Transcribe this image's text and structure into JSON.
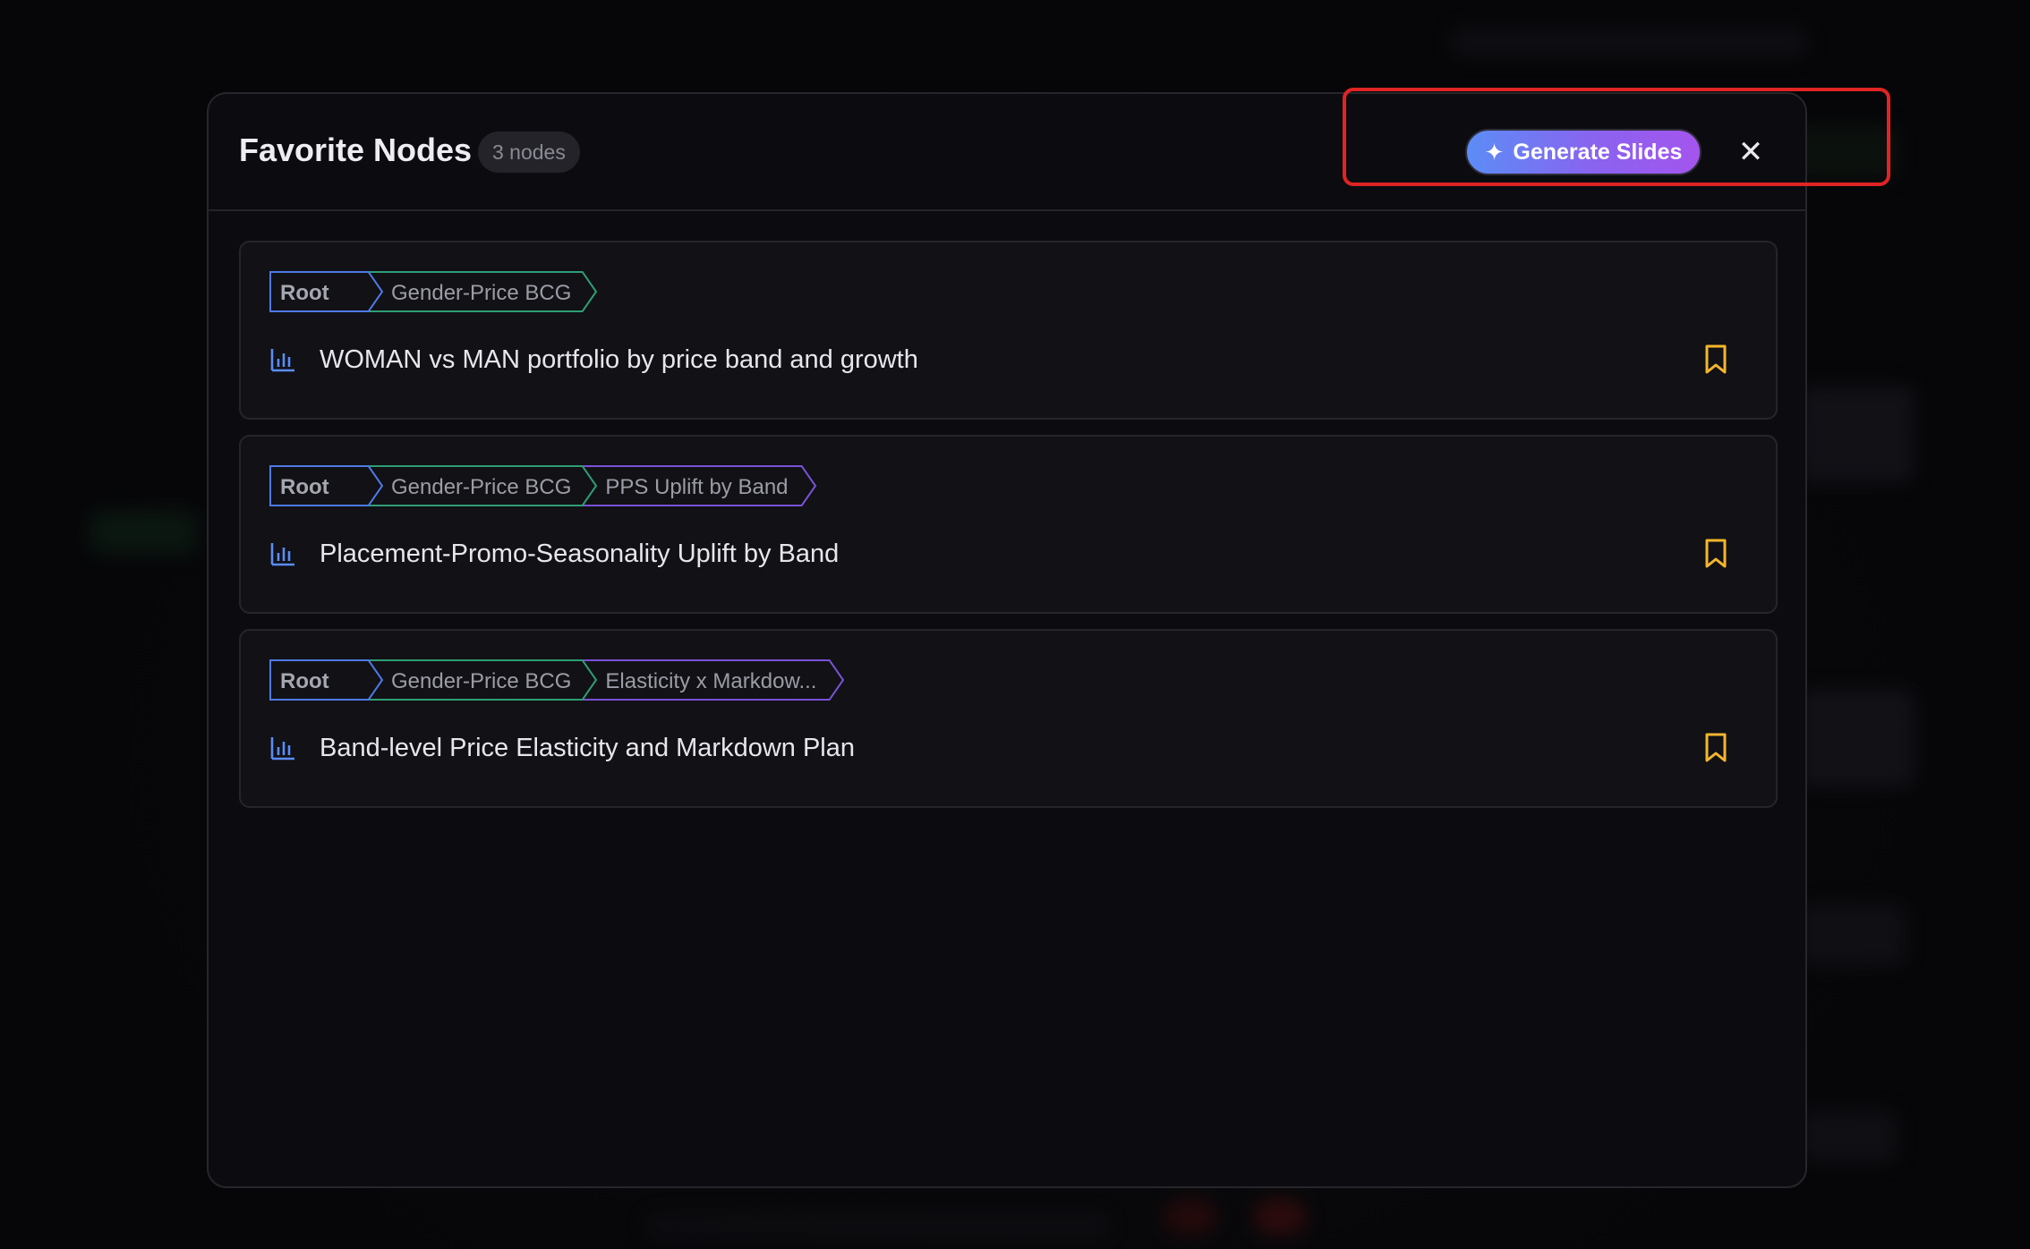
{
  "modal": {
    "title": "Favorite Nodes",
    "count": "3 nodes",
    "generate_label": "Generate Slides",
    "close_glyph": "✕"
  },
  "icons": {
    "generate": "sparkle-icon",
    "close": "close-icon",
    "node": "bar-chart-icon",
    "bookmark": "bookmark-icon"
  },
  "colors": {
    "root_border": "#4f79e6",
    "level1_border": "#2f9e73",
    "level2_border": "#7b52d6",
    "bookmark": "#f5b62c",
    "node_icon": "#5b8df6",
    "highlight": "#e02424"
  },
  "nodes": [
    {
      "crumbs": [
        "Root",
        "Gender-Price BCG"
      ],
      "title": "WOMAN vs MAN portfolio by price band and growth"
    },
    {
      "crumbs": [
        "Root",
        "Gender-Price BCG",
        "PPS Uplift by Band"
      ],
      "title": "Placement-Promo-Seasonality Uplift by Band"
    },
    {
      "crumbs": [
        "Root",
        "Gender-Price BCG",
        "Elasticity x Markdow..."
      ],
      "title": "Band-level Price Elasticity and Markdown Plan"
    }
  ]
}
